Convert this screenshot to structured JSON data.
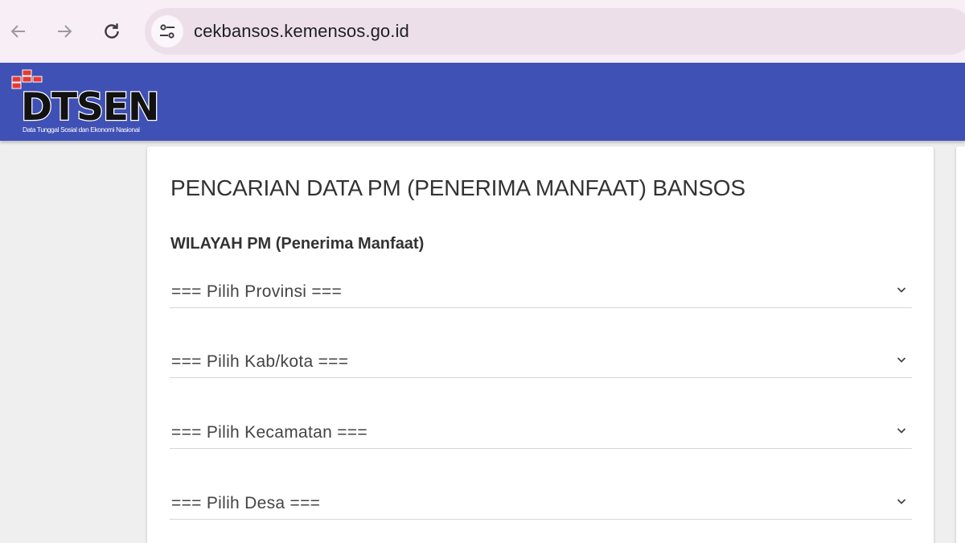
{
  "browser": {
    "url": "cekbansos.kemensos.go.id",
    "icons": {
      "back": "arrow-left-icon",
      "forward": "arrow-right-icon",
      "reload": "reload-icon",
      "site_info": "tune-icon"
    }
  },
  "header": {
    "logo_text": "DTSEN",
    "logo_tagline": "Data Tunggal Sosial dan Ekonomi Nasional",
    "background_color": "#3f51b5"
  },
  "form": {
    "title": "PENCARIAN DATA PM (PENERIMA MANFAAT) BANSOS",
    "section_label": "WILAYAH PM (Penerima Manfaat)",
    "selects": [
      {
        "value": "=== Pilih Provinsi ==="
      },
      {
        "value": "=== Pilih Kab/kota ==="
      },
      {
        "value": "=== Pilih Kecamatan ==="
      },
      {
        "value": "=== Pilih Desa ==="
      }
    ]
  }
}
